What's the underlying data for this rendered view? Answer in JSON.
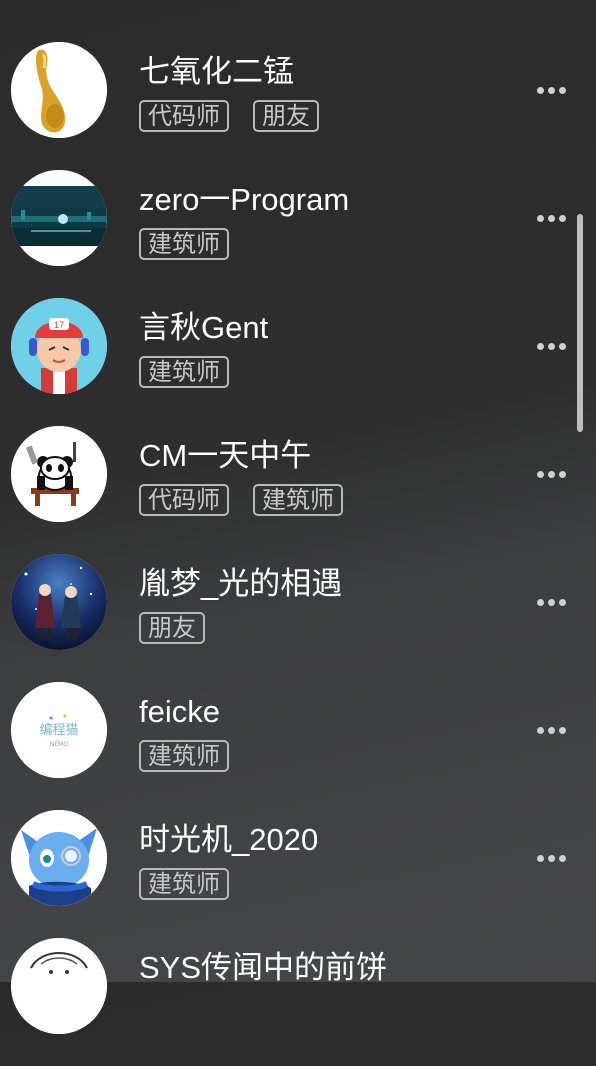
{
  "contacts": [
    {
      "name": "七氧化二锰",
      "tags": [
        "代码师",
        "朋友"
      ],
      "avatar_icon": "golden-spoon-avatar"
    },
    {
      "name": "zero一Program",
      "tags": [
        "建筑师"
      ],
      "avatar_icon": "night-city-avatar"
    },
    {
      "name": "言秋Gent",
      "tags": [
        "建筑师"
      ],
      "avatar_icon": "cartoon-boy-avatar"
    },
    {
      "name": "CM一天中午",
      "tags": [
        "代码师",
        "建筑师"
      ],
      "avatar_icon": "panda-avatar"
    },
    {
      "name": "胤梦_光的相遇",
      "tags": [
        "朋友"
      ],
      "avatar_icon": "starry-sky-avatar"
    },
    {
      "name": "feicke",
      "tags": [
        "建筑师"
      ],
      "avatar_icon": "nemo-logo-avatar"
    },
    {
      "name": "时光机_2020",
      "tags": [
        "建筑师"
      ],
      "avatar_icon": "blue-character-avatar"
    },
    {
      "name": "SYS传闻中的前饼",
      "tags": [],
      "avatar_icon": "sketch-avatar"
    }
  ],
  "nemo_logo_text": "编程猫",
  "nemo_logo_sub": "NEMO",
  "badge_17": "17",
  "colors": {
    "tag_border": "#b8b8b8",
    "text": "#ffffff",
    "background": "#2e2e2e"
  }
}
